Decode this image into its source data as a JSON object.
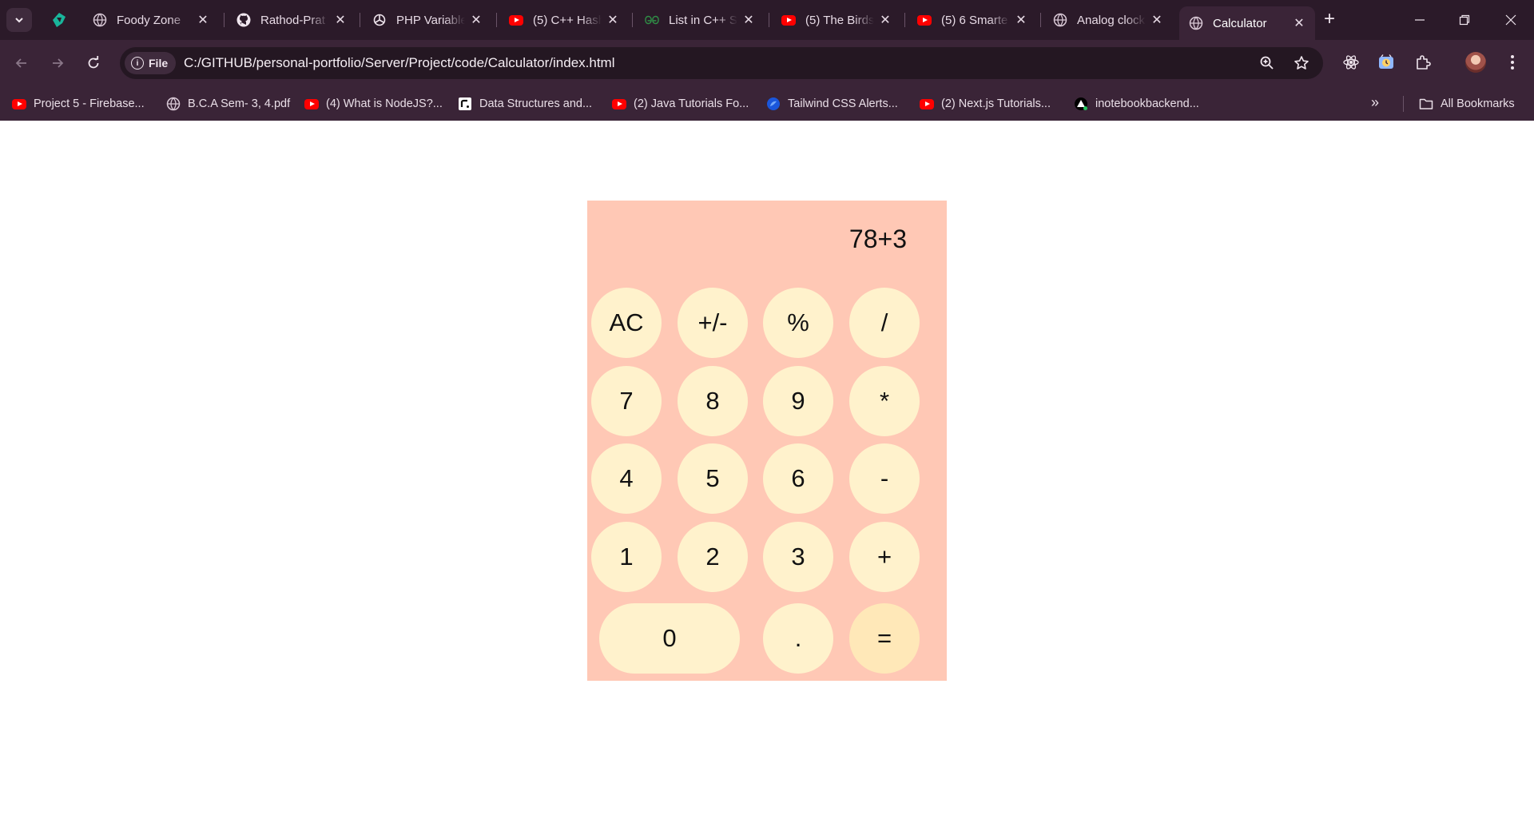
{
  "browser": {
    "tabs": [
      {
        "title": "Foody Zone",
        "favicon": "globe-icon"
      },
      {
        "title": "Rathod-Prat",
        "favicon": "github-icon"
      },
      {
        "title": "PHP Variable",
        "favicon": "openai-icon"
      },
      {
        "title": "(5) C++ Hash",
        "favicon": "youtube-icon"
      },
      {
        "title": "List in C++ S",
        "favicon": "gfg-icon"
      },
      {
        "title": "(5) The Birds",
        "favicon": "youtube-icon"
      },
      {
        "title": "(5) 6 Smarte",
        "favicon": "youtube-icon"
      },
      {
        "title": "Analog clock",
        "favicon": "globe-icon"
      },
      {
        "title": "Calculator",
        "favicon": "globe-icon",
        "active": true
      }
    ],
    "address": {
      "chip_label": "File",
      "url": "C:/GITHUB/personal-portfolio/Server/Project/code/Calculator/index.html"
    },
    "bookmarks": [
      {
        "label": "Project 5 - Firebase...",
        "icon": "youtube-icon"
      },
      {
        "label": "B.C.A Sem- 3, 4.pdf",
        "icon": "globe-icon"
      },
      {
        "label": "(4) What is NodeJS?...",
        "icon": "youtube-icon"
      },
      {
        "label": "Data Structures and...",
        "icon": "codolio-icon"
      },
      {
        "label": "(2) Java Tutorials Fo...",
        "icon": "youtube-icon"
      },
      {
        "label": "Tailwind CSS Alerts...",
        "icon": "flowbite-icon"
      },
      {
        "label": "(2) Next.js Tutorials...",
        "icon": "youtube-icon"
      },
      {
        "label": "inotebookbackend...",
        "icon": "render-icon"
      }
    ],
    "all_bookmarks_label": "All Bookmarks",
    "colors": {
      "frame": "#2b1a29",
      "toolbar": "#3a2437",
      "omnibox": "#241722"
    }
  },
  "calculator": {
    "display": "78+3",
    "keys": [
      "AC",
      "+/-",
      "%",
      "/",
      "7",
      "8",
      "9",
      "*",
      "4",
      "5",
      "6",
      "-",
      "1",
      "2",
      "3",
      "+",
      "0",
      ".",
      "="
    ],
    "colors": {
      "body": "#ffc8b5",
      "key": "#fff2cc",
      "equals": "#ffe8b8"
    }
  }
}
